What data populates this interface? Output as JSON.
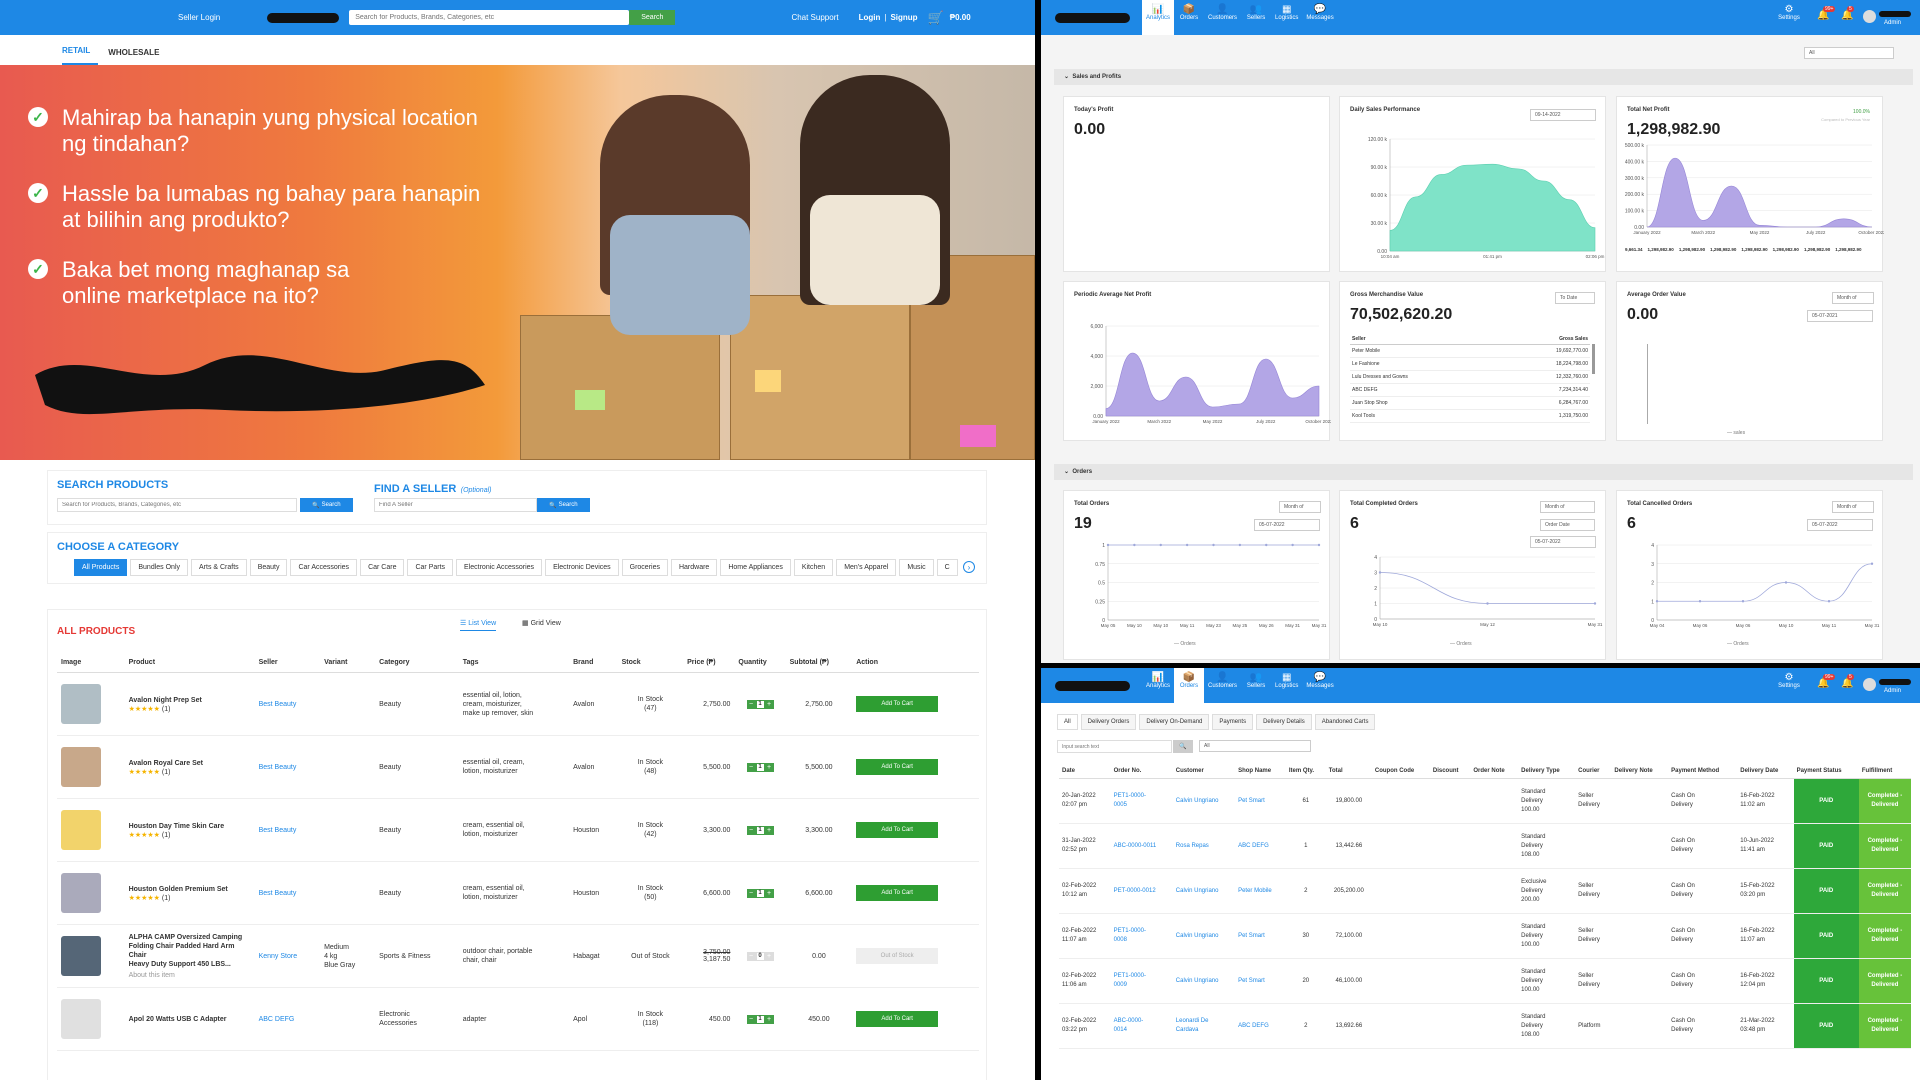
{
  "store": {
    "seller_login": "Seller Login",
    "search_placeholder": "Search for Products, Brands, Categories, etc",
    "search_btn": "Search",
    "chat_support": "Chat Support",
    "login": "Login",
    "sep": "|",
    "signup": "Signup",
    "cart_total": "₱0.00",
    "tabs": [
      "RETAIL",
      "WHOLESALE"
    ],
    "banner_lines": [
      "Mahirap ba hanapin yung physical location\nng tindahan?",
      "Hassle ba lumabas ng bahay para hanapin\nat bilihin ang produkto?",
      "Baka bet mong maghanap sa\nonline marketplace na ito?"
    ],
    "search_products_title": "SEARCH PRODUCTS",
    "search_products_placeholder": "Search for Products, Brands, Categories, etc",
    "find_seller_title": "FIND A SELLER",
    "find_seller_optional": "(Optional)",
    "find_seller_placeholder": "Find A Seller",
    "choose_category": "CHOOSE A CATEGORY",
    "categories": [
      "All Products",
      "Bundles Only",
      "Arts & Crafts",
      "Beauty",
      "Car Accessories",
      "Car Care",
      "Car Parts",
      "Electronic Accessories",
      "Electronic Devices",
      "Groceries",
      "Hardware",
      "Home Appliances",
      "Kitchen",
      "Men's Apparel",
      "Music",
      "C"
    ],
    "all_products": "ALL PRODUCTS",
    "list_view": "List View",
    "grid_view": "Grid View",
    "columns": [
      "Image",
      "Product",
      "Seller",
      "Variant",
      "Category",
      "Tags",
      "Brand",
      "Stock",
      "Price (₱)",
      "Quantity",
      "Subtotal (₱)",
      "Action"
    ],
    "products": [
      {
        "name": "Avalon Night Prep Set",
        "rating": "(1)",
        "seller": "Best Beauty",
        "variant": "",
        "category": "Beauty",
        "tags": "essential oil, lotion,\ncream, moisturizer,\nmake up remover, skin",
        "brand": "Avalon",
        "stock": "In Stock\n(47)",
        "price": "2,750.00",
        "old_price": "",
        "qty": "1",
        "subtotal": "2,750.00",
        "action": "Add To Cart",
        "about": ""
      },
      {
        "name": "Avalon Royal Care Set",
        "rating": "(1)",
        "seller": "Best Beauty",
        "variant": "",
        "category": "Beauty",
        "tags": "essential oil, cream,\nlotion, moisturizer",
        "brand": "Avalon",
        "stock": "In Stock\n(48)",
        "price": "5,500.00",
        "old_price": "",
        "qty": "1",
        "subtotal": "5,500.00",
        "action": "Add To Cart",
        "about": ""
      },
      {
        "name": "Houston Day Time Skin Care",
        "rating": "(1)",
        "seller": "Best Beauty",
        "variant": "",
        "category": "Beauty",
        "tags": "cream, essential oil,\nlotion, moisturizer",
        "brand": "Houston",
        "stock": "In Stock\n(42)",
        "price": "3,300.00",
        "old_price": "",
        "qty": "1",
        "subtotal": "3,300.00",
        "action": "Add To Cart",
        "about": ""
      },
      {
        "name": "Houston Golden Premium Set",
        "rating": "(1)",
        "seller": "Best Beauty",
        "variant": "",
        "category": "Beauty",
        "tags": "cream, essential oil,\nlotion, moisturizer",
        "brand": "Houston",
        "stock": "In Stock\n(50)",
        "price": "6,600.00",
        "old_price": "",
        "qty": "1",
        "subtotal": "6,600.00",
        "action": "Add To Cart",
        "about": ""
      },
      {
        "name": "ALPHA CAMP Oversized Camping\nFolding Chair Padded Hard Arm Chair\nHeavy Duty Support 450 LBS...",
        "rating": "",
        "seller": "Kenny Store",
        "variant": "Medium\n4 kg\nBlue Gray",
        "category": "Sports & Fitness",
        "tags": "outdoor chair, portable\nchair, chair",
        "brand": "Habagat",
        "stock": "Out of Stock",
        "price": "3,187.50",
        "old_price": "3,750.00",
        "qty": "0",
        "subtotal": "0.00",
        "action": "Out of Stock",
        "about": "About this item"
      },
      {
        "name": "Apol 20 Watts USB C Adapter",
        "rating": "",
        "seller": "ABC DEFG",
        "variant": "",
        "category": "Electronic\nAccessories",
        "tags": "adapter",
        "brand": "Apol",
        "stock": "In Stock\n(118)",
        "price": "450.00",
        "old_price": "",
        "qty": "1",
        "subtotal": "450.00",
        "action": "Add To Cart",
        "about": ""
      }
    ]
  },
  "admin": {
    "nav": [
      "Analytics",
      "Orders",
      "Customers",
      "Sellers",
      "Logistics",
      "Messages"
    ],
    "settings": "Settings",
    "admin_label": "Admin",
    "badge1": "99+",
    "badge2": "5",
    "filter_all": "All",
    "sales_section": "Sales and Profits",
    "todays_profit": "Today's Profit",
    "todays_profit_val": "0.00",
    "daily_sales": "Daily Sales Performance",
    "daily_date": "09-14-2022",
    "total_net": "Total Net Profit",
    "total_net_val": "1,298,982.90",
    "total_net_pct": "100.0%",
    "total_net_note": "Compared to Previous Year",
    "periodic": "Periodic Average Net Profit",
    "gmv": "Gross Merchandise Value",
    "gmv_val": "70,502,620.20",
    "gmv_sel": "To Date",
    "gmv_cols": [
      "Seller",
      "Gross Sales"
    ],
    "gmv_rows": [
      [
        "Peter Mobile",
        "19,692,770.00"
      ],
      [
        "Le Fashione",
        "18,224,798.00"
      ],
      [
        "Lulu Dresses and Gowns",
        "12,332,760.00"
      ],
      [
        "ABC DEFG",
        "7,234,314.40"
      ],
      [
        "Juan Stop Shop",
        "6,284,767.00"
      ],
      [
        "Kool Tools",
        "1,319,750.00"
      ]
    ],
    "aov": "Average Order Value",
    "aov_val": "0.00",
    "aov_sel": "Month of",
    "aov_date": "05-07-2021",
    "aov_legend": "sales",
    "orders_section": "Orders",
    "total_orders": "Total Orders",
    "total_orders_val": "19",
    "to_sel": "Month of",
    "to_date": "05-07-2022",
    "completed": "Total Completed Orders",
    "completed_val": "6",
    "co_sel": "Month of",
    "co_sel2": "Order Date",
    "co_date": "05-07-2022",
    "cancelled": "Total Cancelled Orders",
    "cancelled_val": "6",
    "ca_sel": "Month of",
    "ca_date": "05-07-2022",
    "orders_legend": "Orders",
    "net_bottom": [
      "9,661.34",
      "1,298,982.90",
      "1,298,982.90",
      "1,298,982.90",
      "1,298,982.90",
      "1,298,982.90",
      "1,298,982.90",
      "1,298,982.90"
    ],
    "order_tabs": [
      "All",
      "Delivery Orders",
      "Delivery On-Demand",
      "Payments",
      "Delivery Details",
      "Abandoned Carts"
    ],
    "order_search_placeholder": "Input search text",
    "order_filter": "All",
    "order_cols": [
      "Date",
      "Order No.",
      "Customer",
      "Shop Name",
      "Item Qty.",
      "Total",
      "Coupon Code",
      "Discount",
      "Order Note",
      "Delivery Type",
      "Courier",
      "Delivery Note",
      "Payment Method",
      "Delivery Date",
      "Payment Status",
      "Fulfillment"
    ],
    "orders": [
      {
        "date": "20-Jan-2022\n02:07 pm",
        "no": "PET1-0000-\n0005",
        "customer": "Calvin Ungriano",
        "shop": "Pet Smart",
        "qty": "61",
        "total": "19,800.00",
        "type": "Standard\nDelivery\n100.00",
        "courier": "Seller\nDelivery",
        "pay": "Cash On\nDelivery",
        "ddate": "16-Feb-2022\n11:02 am",
        "status": "PAID",
        "ful": "Completed -\nDelivered"
      },
      {
        "date": "31-Jan-2022\n02:52 pm",
        "no": "ABC-0000-0011",
        "customer": "Rosa Repas",
        "shop": "ABC DEFG",
        "qty": "1",
        "total": "13,442.66",
        "type": "Standard\nDelivery\n108.00",
        "courier": "",
        "pay": "Cash On\nDelivery",
        "ddate": "10-Jun-2022\n11:41 am",
        "status": "PAID",
        "ful": "Completed -\nDelivered"
      },
      {
        "date": "02-Feb-2022\n10:12 am",
        "no": "PET-0000-0012",
        "customer": "Calvin Ungriano",
        "shop": "Peter Mobile",
        "qty": "2",
        "total": "205,200.00",
        "type": "Exclusive\nDelivery\n200.00",
        "courier": "Seller\nDelivery",
        "pay": "Cash On\nDelivery",
        "ddate": "15-Feb-2022\n03:20 pm",
        "status": "PAID",
        "ful": "Completed -\nDelivered"
      },
      {
        "date": "02-Feb-2022\n11:07 am",
        "no": "PET1-0000-\n0008",
        "customer": "Calvin Ungriano",
        "shop": "Pet Smart",
        "qty": "30",
        "total": "72,100.00",
        "type": "Standard\nDelivery\n100.00",
        "courier": "Seller\nDelivery",
        "pay": "Cash On\nDelivery",
        "ddate": "16-Feb-2022\n11:07 am",
        "status": "PAID",
        "ful": "Completed -\nDelivered"
      },
      {
        "date": "02-Feb-2022\n11:06 am",
        "no": "PET1-0000-\n0009",
        "customer": "Calvin Ungriano",
        "shop": "Pet Smart",
        "qty": "20",
        "total": "46,100.00",
        "type": "Standard\nDelivery\n100.00",
        "courier": "Seller\nDelivery",
        "pay": "Cash On\nDelivery",
        "ddate": "16-Feb-2022\n12:04 pm",
        "status": "PAID",
        "ful": "Completed -\nDelivered"
      },
      {
        "date": "02-Feb-2022\n03:22 pm",
        "no": "ABC-0000-\n0014",
        "customer": "Leonardi De\nCardava",
        "shop": "ABC DEFG",
        "qty": "2",
        "total": "13,692.66",
        "type": "Standard\nDelivery\n108.00",
        "courier": "Platform",
        "pay": "Cash On\nDelivery",
        "ddate": "21-Mar-2022\n03:48 pm",
        "status": "PAID",
        "ful": "Completed -\nDelivered"
      }
    ]
  },
  "chart_data": [
    {
      "type": "area",
      "title": "Daily Sales Performance",
      "x": [
        "10:04 am",
        "01:41 pm",
        "02:06 pm"
      ],
      "ylim": [
        0,
        120000
      ],
      "yticks": [
        "0.00",
        "30.00 k",
        "60.00 k",
        "90.00 k",
        "120.00 k"
      ],
      "values": [
        22000,
        58000,
        82000,
        92000,
        93000,
        88000,
        75000,
        55000,
        25000
      ]
    },
    {
      "type": "area",
      "title": "Total Net Profit",
      "x": [
        "January 2022",
        "March 2022",
        "May 2022",
        "July 2022",
        "October 2022"
      ],
      "ylim": [
        0,
        500000
      ],
      "yticks": [
        "0.00",
        "100.00 k",
        "200.00 k",
        "300.00 k",
        "400.00 k",
        "500.00 k"
      ],
      "values": [
        0,
        420000,
        40000,
        250000,
        10000,
        0,
        0,
        50000,
        0
      ]
    },
    {
      "type": "area",
      "title": "Periodic Average Net Profit",
      "x": [
        "January 2022",
        "March 2022",
        "May 2022",
        "July 2022",
        "October 2022"
      ],
      "ylim": [
        0,
        6000
      ],
      "yticks": [
        "0.00",
        "2,000",
        "4,000",
        "6,000"
      ],
      "values": [
        500,
        4200,
        1000,
        2600,
        600,
        800,
        3800,
        1200,
        2000
      ]
    },
    {
      "type": "line",
      "title": "Total Orders",
      "x": [
        "May 05",
        "May 10",
        "May 10",
        "May 11",
        "May 23",
        "May 25",
        "May 26",
        "May 31",
        "May 31"
      ],
      "ylim": [
        0,
        1
      ],
      "yticks": [
        "0",
        "0.25",
        "0.5",
        "0.75",
        "1"
      ],
      "values": [
        1,
        1,
        1,
        1,
        1,
        1,
        1,
        1,
        1
      ]
    },
    {
      "type": "line",
      "title": "Total Completed Orders",
      "x": [
        "May 10",
        "May 12",
        "May 31"
      ],
      "ylim": [
        0,
        4
      ],
      "yticks": [
        "0",
        "1",
        "2",
        "3",
        "4"
      ],
      "values": [
        3,
        1,
        1
      ]
    },
    {
      "type": "line",
      "title": "Total Cancelled Orders",
      "x": [
        "May 04",
        "May 06",
        "May 06",
        "May 10",
        "May 11",
        "May 31"
      ],
      "ylim": [
        0,
        4
      ],
      "yticks": [
        "0",
        "1",
        "2",
        "3",
        "4"
      ],
      "values": [
        1,
        1,
        1,
        2,
        1,
        3
      ]
    }
  ]
}
